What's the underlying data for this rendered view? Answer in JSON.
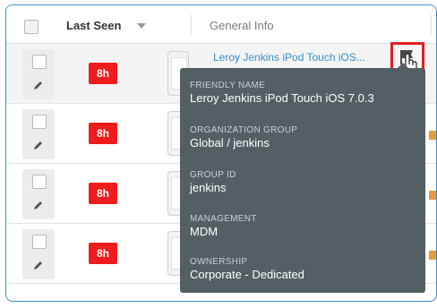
{
  "header": {
    "last_seen": "Last Seen",
    "general_info": "General Info"
  },
  "rows": [
    {
      "badge": "8h",
      "device_name": "Leroy Jenkins iPod Touch iOS..."
    },
    {
      "badge": "8h"
    },
    {
      "badge": "8h"
    },
    {
      "badge": "8h"
    }
  ],
  "tooltip": {
    "friendly_name_label": "FRIENDLY NAME",
    "friendly_name": "Leroy Jenkins iPod Touch iOS 7.0.3",
    "org_group_label": "ORGANIZATION GROUP",
    "org_group": "Global / jenkins",
    "group_id_label": "GROUP ID",
    "group_id": "jenkins",
    "management_label": "MANAGEMENT",
    "management": "MDM",
    "ownership_label": "OWNERSHIP",
    "ownership": "Corporate - Dedicated"
  },
  "colors": {
    "badge_red": "#ee1c1c",
    "link_blue": "#3a8fc7",
    "tooltip_bg": "#535f63",
    "highlight_box": "#e02020"
  },
  "icons": [
    "sort-arrow-icon",
    "pencil-icon",
    "device-icon",
    "flag-icon",
    "hand-cursor-icon"
  ]
}
